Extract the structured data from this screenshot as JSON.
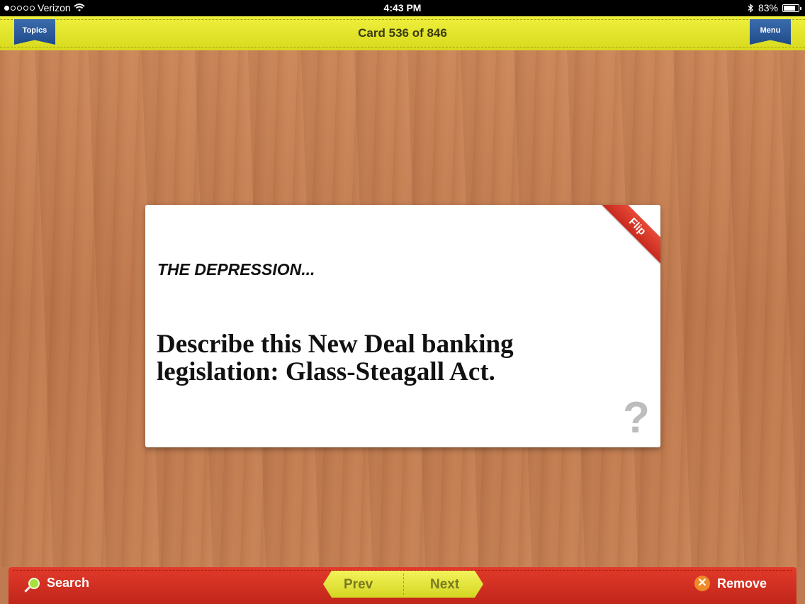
{
  "status_bar": {
    "carrier": "Verizon",
    "time": "4:43 PM",
    "battery": "83%",
    "signal_dots": 5,
    "signal_filled": 1
  },
  "header": {
    "card_counter": "Card 536 of 846",
    "topics_label": "Topics",
    "menu_label": "Menu"
  },
  "card": {
    "topic": "THE DEPRESSION...",
    "question": "Describe this New Deal banking legislation: Glass-Steagall Act.",
    "flip_label": "Flip",
    "hint_symbol": "?"
  },
  "footer": {
    "search_label": "Search",
    "prev_label": "Prev",
    "next_label": "Next",
    "remove_label": "Remove"
  },
  "colors": {
    "header_yellow": "#e4e62c",
    "ribbon_blue": "#2a5a9c",
    "footer_red": "#d0301f",
    "flip_red": "#d93a2b"
  }
}
